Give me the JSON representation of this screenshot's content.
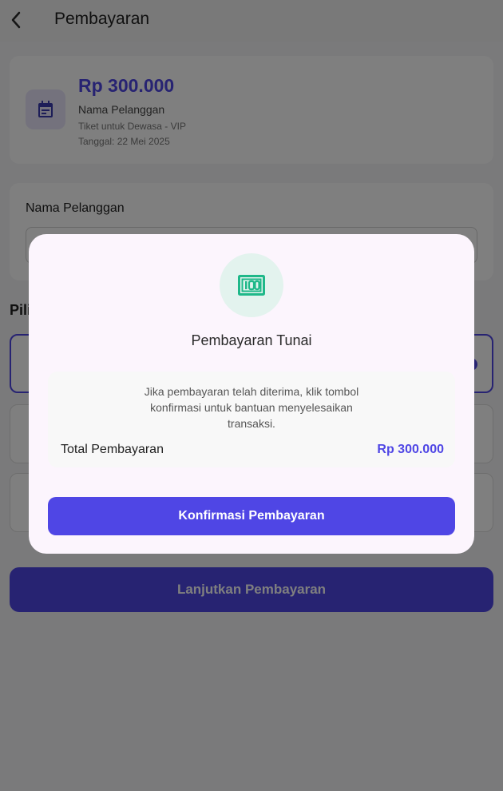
{
  "header": {
    "title": "Pembayaran",
    "back_icon": "chevron-left-icon"
  },
  "summary": {
    "price": "Rp 300.000",
    "customer_name": "Nama Pelanggan",
    "ticket": "Tiket untuk Dewasa - VIP",
    "date": "Tanggal: 22 Mei 2025",
    "icon": "calendar-icon"
  },
  "form": {
    "label": "Nama Pelanggan"
  },
  "methods": {
    "title": "Pili"
  },
  "footer": {
    "continue_label": "Lanjutkan Pembayaran"
  },
  "modal": {
    "icon": "cash-icon",
    "title": "Pembayaran Tunai",
    "info": "Jika pembayaran telah diterima, klik tombol konfirmasi untuk bantuan menyelesaikan transaksi.",
    "total_label": "Total Pembayaran",
    "total_value": "Rp 300.000",
    "confirm_label": "Konfirmasi Pembayaran"
  },
  "colors": {
    "accent": "#4f46e5",
    "cash_green": "#1fb889",
    "modal_bg": "#fcf5fd"
  }
}
